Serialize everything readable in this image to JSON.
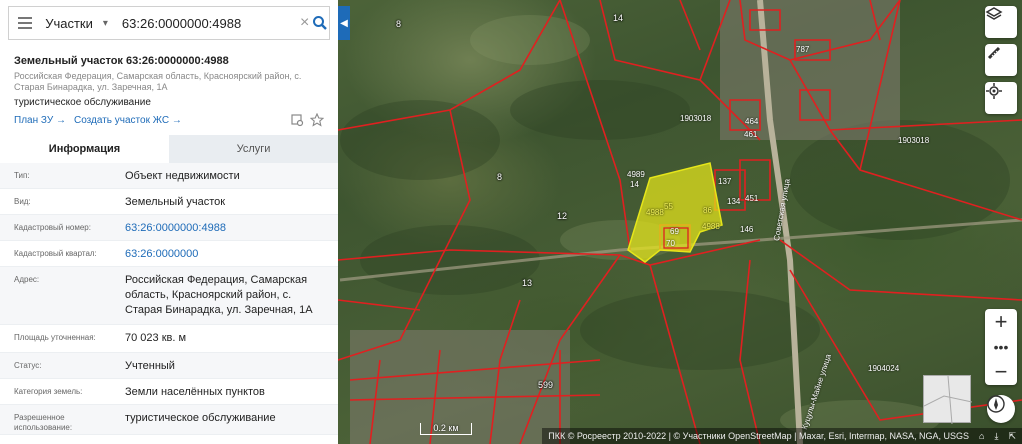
{
  "search": {
    "category": "Участки",
    "query": "63:26:0000000:4988"
  },
  "object": {
    "title": "Земельный участок 63:26:0000000:4988",
    "address": "Российская Федерация, Самарская область, Красноярский район, с. Старая Бинарадка, ул. Заречная, 1А",
    "purpose": "туристическое обслуживание",
    "links": {
      "plan": "План ЗУ →",
      "create": "Создать участок ЖС →"
    }
  },
  "tabs": [
    {
      "label": "Информация",
      "active": true
    },
    {
      "label": "Услуги",
      "active": false
    }
  ],
  "info_rows": [
    {
      "key": "Тип:",
      "value": "Объект недвижимости",
      "link": false
    },
    {
      "key": "Вид:",
      "value": "Земельный участок",
      "link": false
    },
    {
      "key": "Кадастровый номер:",
      "value": "63:26:0000000:4988",
      "link": true
    },
    {
      "key": "Кадастровый квартал:",
      "value": "63:26:0000000",
      "link": true
    },
    {
      "key": "Адрес:",
      "value": "Российская Федерация, Самарская область, Красноярский район, с. Старая Бинарадка, ул. Заречная, 1А",
      "link": false
    },
    {
      "key": "Площадь уточненная:",
      "value": "70 023 кв. м",
      "link": false
    },
    {
      "key": "Статус:",
      "value": "Учтенный",
      "link": false
    },
    {
      "key": "Категория земель:",
      "value": "Земли населённых пунктов",
      "link": false
    },
    {
      "key": "Разрешенное использование:",
      "value": "туристическое обслуживание",
      "link": false
    }
  ],
  "map": {
    "labels": [
      "8",
      "14",
      "8",
      "12",
      "13",
      "599",
      "4989",
      "14",
      "1903018",
      "1903018",
      "1904024",
      "137",
      "134",
      "451",
      "146",
      "69",
      "70",
      "464",
      "461",
      "787"
    ],
    "highlight_labels": [
      "4988",
      "55",
      "86",
      "4988"
    ],
    "streets": [
      "Советская улица",
      "Куцулы-Майне улица"
    ],
    "scale": "0.2 км",
    "attribution": "ПКК © Росреестр 2010-2022 | © Участники OpenStreetMap | Maxar, Esri, Intermap, NASA, NGA, USGS",
    "colors": {
      "boundary": "#e02020",
      "highlight": "#e6e61a",
      "accent": "#1e6bb8"
    }
  }
}
